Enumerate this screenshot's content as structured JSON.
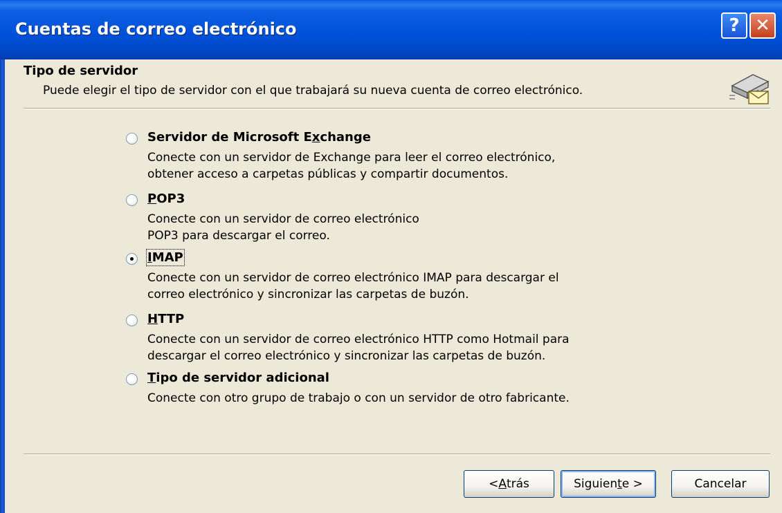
{
  "window": {
    "title": "Cuentas de correo electrónico",
    "help_button": "?",
    "close_button": "✕"
  },
  "header": {
    "title": "Tipo de servidor",
    "subtitle": "Puede elegir el tipo de servidor con el que trabajará su nueva cuenta de correo electrónico.",
    "icon": "server-mail-icon"
  },
  "options": [
    {
      "label_parts": [
        "Servidor de Microsoft E",
        "x",
        "change"
      ],
      "desc": [
        "Conecte con un servidor de Exchange para leer el correo electrónico,",
        "obtener acceso a carpetas públicas y compartir documentos."
      ],
      "checked": false
    },
    {
      "label_parts": [
        "",
        "P",
        "OP3"
      ],
      "desc": [
        "Conecte con un servidor de correo electrónico",
        "POP3 para descargar el correo."
      ],
      "checked": false
    },
    {
      "label_parts": [
        "",
        "I",
        "MAP"
      ],
      "desc": [
        "Conecte con un servidor de correo electrónico IMAP para descargar el",
        "correo electrónico y sincronizar las carpetas de buzón."
      ],
      "checked": true
    },
    {
      "label_parts": [
        "",
        "H",
        "TTP"
      ],
      "desc": [
        "Conecte con un servidor de correo electrónico HTTP como Hotmail para",
        "descargar el correo electrónico y sincronizar las carpetas de buzón."
      ],
      "checked": false
    },
    {
      "label_parts": [
        "",
        "T",
        "ipo de servidor adicional"
      ],
      "desc": [
        "Conecte con otro grupo de trabajo o con un servidor de otro fabricante."
      ],
      "checked": false
    }
  ],
  "buttons": {
    "back": [
      "< ",
      "A",
      "trás"
    ],
    "next": [
      "Siguien",
      "t",
      "e >"
    ],
    "cancel": "Cancelar"
  }
}
